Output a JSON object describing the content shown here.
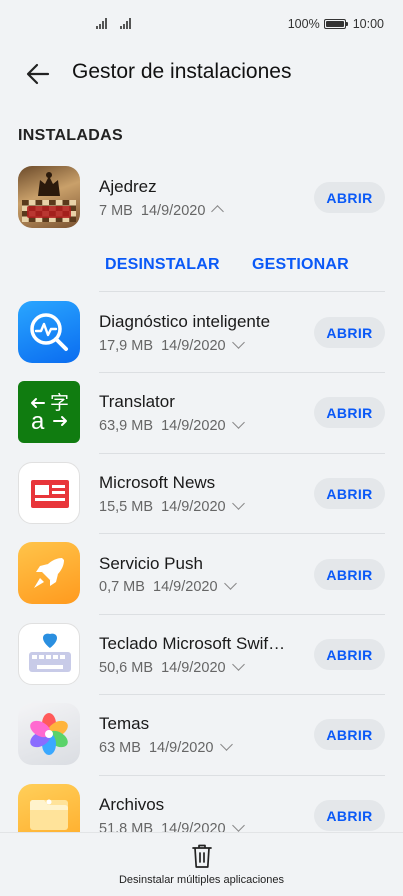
{
  "status": {
    "battery": "100%",
    "time": "10:00"
  },
  "header": {
    "title": "Gestor de instalaciones"
  },
  "section": {
    "label": "INSTALADAS"
  },
  "expanded_actions": {
    "uninstall": "DESINSTALAR",
    "manage": "GESTIONAR"
  },
  "apps": [
    {
      "name": "Ajedrez",
      "size": "7 MB",
      "date": "14/9/2020",
      "button": "ABRIR",
      "icon": "chess-icon",
      "expanded": true
    },
    {
      "name": "Diagnóstico inteligente",
      "size": "17,9 MB",
      "date": "14/9/2020",
      "button": "ABRIR",
      "icon": "diagnostics-icon",
      "expanded": false
    },
    {
      "name": "Translator",
      "size": "63,9 MB",
      "date": "14/9/2020",
      "button": "ABRIR",
      "icon": "translator-icon",
      "expanded": false
    },
    {
      "name": "Microsoft News",
      "size": "15,5 MB",
      "date": "14/9/2020",
      "button": "ABRIR",
      "icon": "news-icon",
      "expanded": false
    },
    {
      "name": "Servicio Push",
      "size": "0,7 MB",
      "date": "14/9/2020",
      "button": "ABRIR",
      "icon": "rocket-icon",
      "expanded": false
    },
    {
      "name": "Teclado Microsoft Swif…",
      "size": "50,6 MB",
      "date": "14/9/2020",
      "button": "ABRIR",
      "icon": "keyboard-icon",
      "expanded": false
    },
    {
      "name": "Temas",
      "size": "63 MB",
      "date": "14/9/2020",
      "button": "ABRIR",
      "icon": "themes-icon",
      "expanded": false
    },
    {
      "name": "Archivos",
      "size": "51,8 MB",
      "date": "14/9/2020",
      "button": "ABRIR",
      "icon": "files-icon",
      "expanded": false
    }
  ],
  "bottom": {
    "label": "Desinstalar múltiples aplicaciones"
  },
  "colors": {
    "accent": "#0a59f7",
    "background": "#f1f3f5",
    "button_bg": "#e4e7ea"
  }
}
